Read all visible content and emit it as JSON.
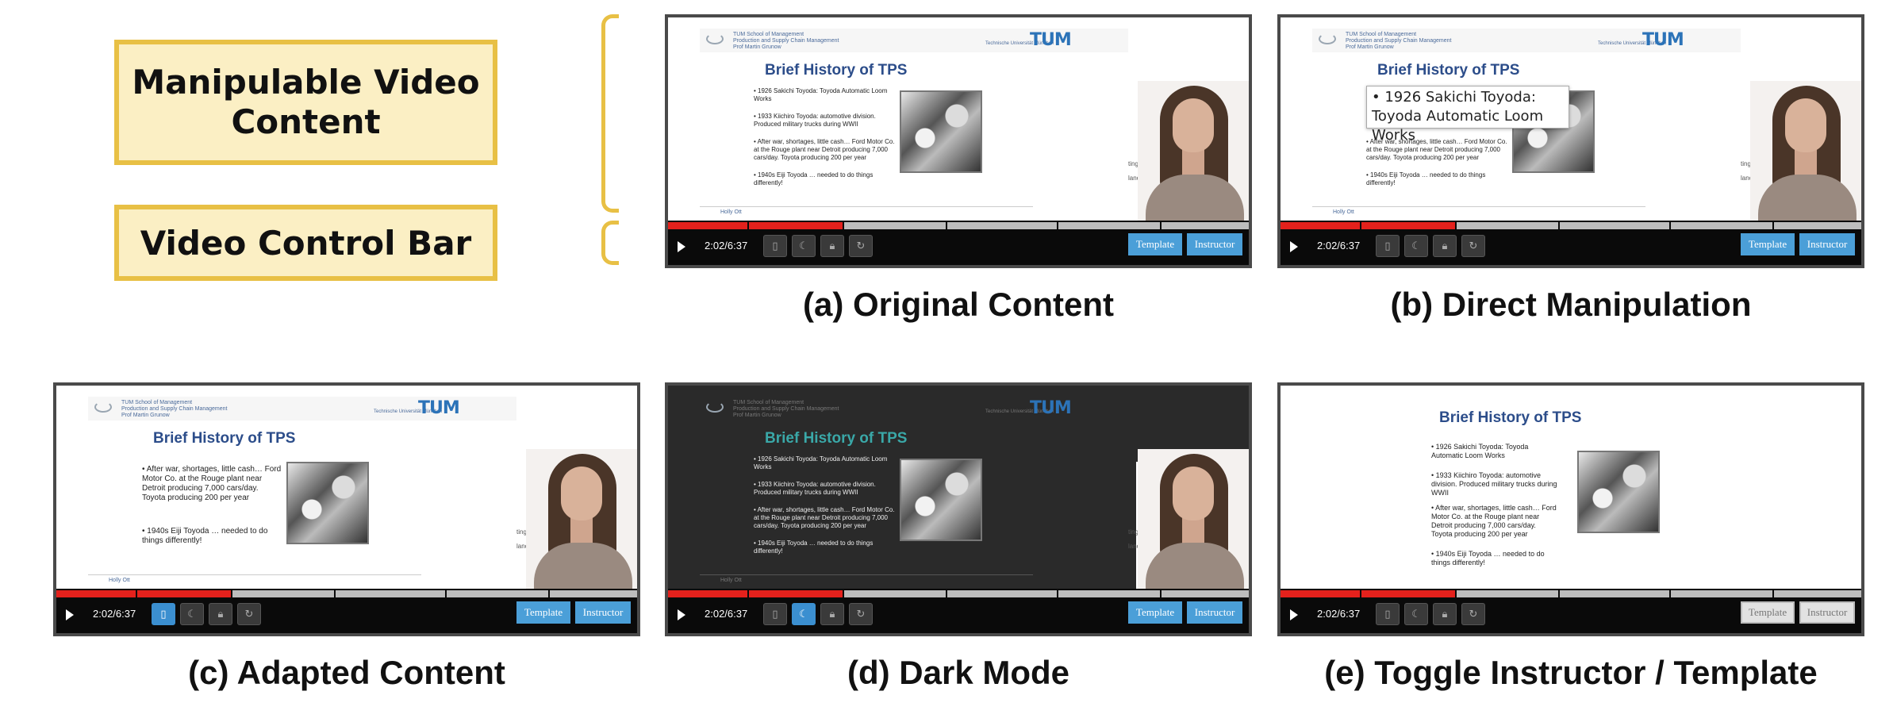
{
  "legend": {
    "content_label": "Manipulable Video Content",
    "control_label": "Video Control Bar"
  },
  "slide": {
    "header_lines": [
      "TUM School of Management",
      "Production and Supply Chain Management",
      "Prof Martin Grunow"
    ],
    "university": "Technische Universität München",
    "logo": "TUM",
    "title": "Brief History of TPS",
    "bullets": [
      "• 1926 Sakichi Toyoda: Toyoda Automatic Loom Works",
      "• 1933 Kiichiro Toyoda: automotive division. Produced military trucks during WWII",
      "• After war, shortages, little cash… Ford Motor Co. at the Rouge plant near Detroit producing 7,000 cars/day. Toyota producing 200 per year",
      "• 1940s Eiji Toyoda … needed to do things differently!"
    ],
    "footer": "Holly Ott",
    "side_text": [
      "ting",
      "lanos"
    ]
  },
  "player": {
    "time": "2:02/6:37",
    "progress_fraction": 0.3,
    "template_label": "Template",
    "instructor_label": "Instructor",
    "icons": [
      "mobile-icon",
      "moon-icon",
      "lock-icon",
      "reset-icon"
    ]
  },
  "panels": {
    "a": {
      "caption": "(a) Original Content"
    },
    "b": {
      "caption": "(b) Direct Manipulation",
      "overlay_text": "• 1926 Sakichi Toyoda: Toyoda Automatic Loom Works"
    },
    "c": {
      "caption": "(c) Adapted Content"
    },
    "d": {
      "caption": "(d) Dark Mode"
    },
    "e": {
      "caption": "(e) Toggle Instructor / Template"
    }
  },
  "colors": {
    "accent": "#e8c045",
    "progress": "#e4211c",
    "button": "#4b9fd8",
    "title": "#2c4d8a"
  }
}
